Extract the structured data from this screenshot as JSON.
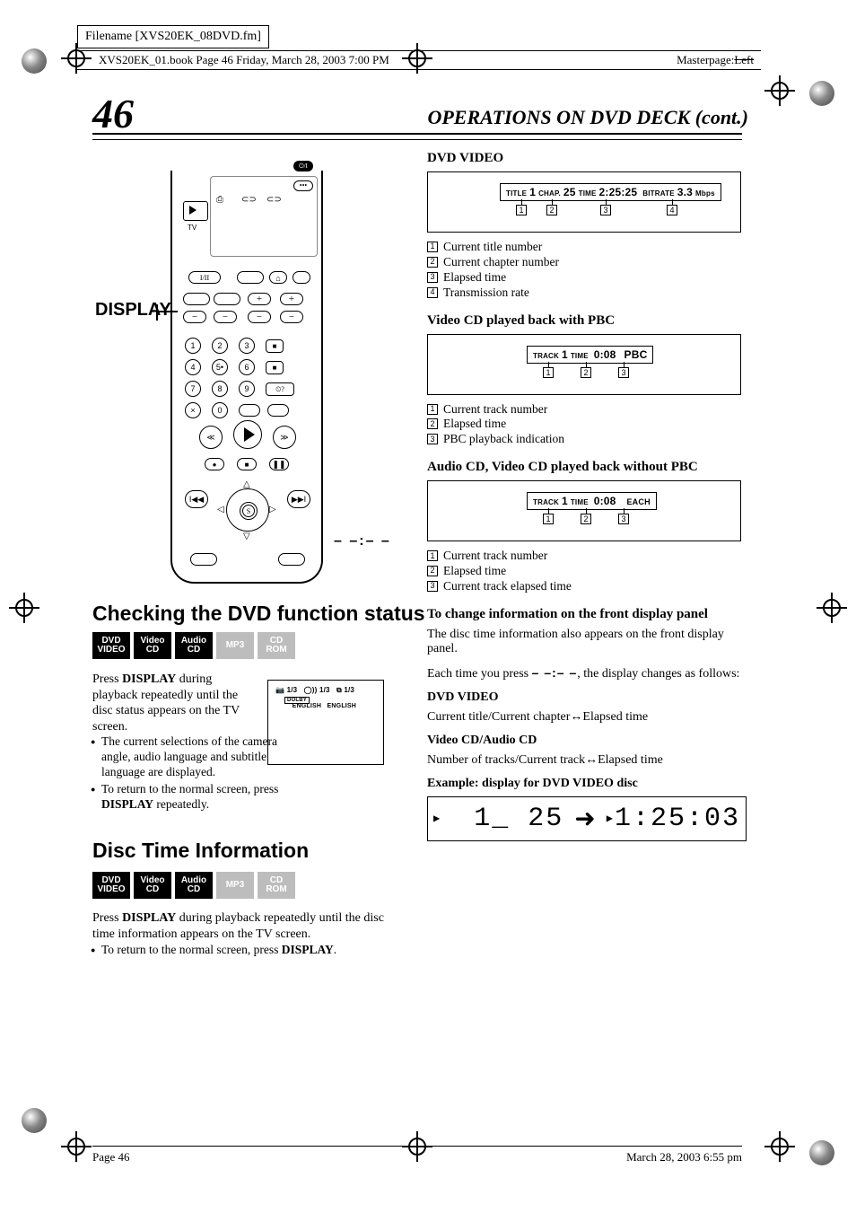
{
  "meta": {
    "filename_label": "Filename [XVS20EK_08DVD.fm]",
    "bookline": "XVS20EK_01.book  Page 46  Friday, March 28, 2003  7:00 PM",
    "masterpage_label": "Masterpage:",
    "masterpage_value": "Left"
  },
  "page_number": "46",
  "section_title": "OPERATIONS ON DVD DECK (cont.)",
  "remote": {
    "display_label": "DISPLAY"
  },
  "heading_a": "Checking the DVD function status",
  "badges": {
    "dvd_video": [
      "DVD",
      "VIDEO"
    ],
    "video_cd": [
      "Video",
      "CD"
    ],
    "audio_cd": [
      "Audio",
      "CD"
    ],
    "mp3": "MP3",
    "cd_rom": [
      "CD",
      "ROM"
    ]
  },
  "para1_pre": "Press ",
  "para1_bold": "DISPLAY",
  "para1_post": " during playback repeatedly until the disc status appears on the TV screen.",
  "bullets1": [
    "The current selections of the camera angle, audio language and subtitle language are displayed.",
    "To return to the normal screen, press DISPLAY repeatedly."
  ],
  "osd": {
    "cam": "1/3",
    "aud_n": "1/3",
    "aud_l": "ENGLISH",
    "sub_n": "1/3",
    "sub_l": "ENGLISH"
  },
  "heading_b": "Disc Time Information",
  "para2_pre": "Press ",
  "para2_bold": "DISPLAY",
  "para2_post": " during playback repeatedly until the disc time information appears on the TV screen.",
  "bullets2": [
    "To return to the normal screen, press DISPLAY."
  ],
  "right": {
    "dvd_video_head": "DVD VIDEO",
    "dvd_lcd_parts": {
      "title_lbl": "TITLE",
      "title_v": "1",
      "chap_lbl": "CHAP.",
      "chap_v": "25",
      "time_lbl": "TIME",
      "time_v": "2:25:25",
      "rate_lbl": "BITRATE",
      "rate_v": "3.3",
      "rate_u": "Mbps"
    },
    "dvd_legend": [
      "Current title number",
      "Current chapter number",
      "Elapsed time",
      "Transmission rate"
    ],
    "vcd_pbc_head": "Video CD played back with PBC",
    "vcd_pbc_lcd": {
      "track_lbl": "TRACK",
      "track_v": "1",
      "time_lbl": "TIME",
      "time_v": "0:08",
      "pbc": "PBC"
    },
    "vcd_pbc_legend": [
      "Current track number",
      "Elapsed time",
      "PBC playback indication"
    ],
    "acd_head": "Audio CD, Video CD played back without PBC",
    "acd_lcd": {
      "track_lbl": "TRACK",
      "track_v": "1",
      "time_lbl": "TIME",
      "time_v": "0:08",
      "each": "EACH"
    },
    "acd_legend": [
      "Current track number",
      "Elapsed time",
      "Current track elapsed time"
    ],
    "change_head": "To change information on the front display panel",
    "change_body": "The disc time information also appears on the front display panel.",
    "each_press_pre": "Each time you press ",
    "each_press_dash": "– –:– –",
    "each_press_post": ", the display changes as follows:",
    "dv_sub_head": "DVD VIDEO",
    "dv_sub_body_a": "Current title/Current chapter",
    "dv_sub_body_b": "Elapsed time",
    "vc_sub_head": "Video CD/Audio CD",
    "vc_sub_body_a": "Number of tracks/Current track",
    "vc_sub_body_b": "Elapsed time",
    "example_head": "Example: display for DVD VIDEO disc",
    "example_seg1": "1_ 25",
    "example_seg2": "1:25:03"
  },
  "footer": {
    "left": "Page 46",
    "right": "March 28, 2003  6:55 pm"
  }
}
